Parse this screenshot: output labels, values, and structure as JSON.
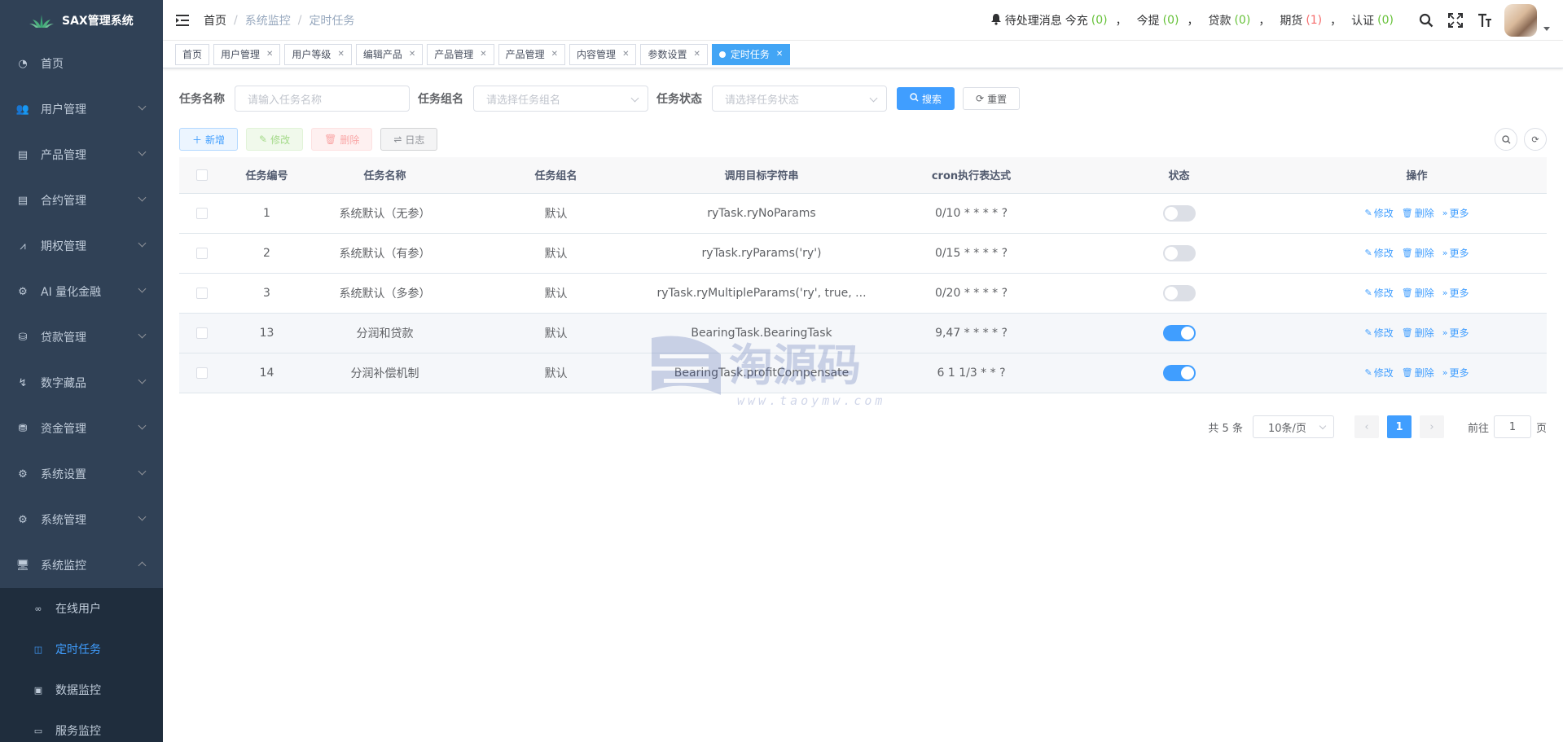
{
  "app": {
    "title": "SAX管理系统"
  },
  "sidebar": {
    "items": [
      {
        "label": "首页",
        "icon": "dashboard-icon",
        "glyph": "◔",
        "has_arrow": false
      },
      {
        "label": "用户管理",
        "icon": "peoples-icon",
        "glyph": "👥",
        "has_arrow": true
      },
      {
        "label": "产品管理",
        "icon": "document-icon",
        "glyph": "▤",
        "has_arrow": true
      },
      {
        "label": "合约管理",
        "icon": "contract-icon",
        "glyph": "▤",
        "has_arrow": true
      },
      {
        "label": "期权管理",
        "icon": "chart-icon",
        "glyph": "⩘",
        "has_arrow": true
      },
      {
        "label": "AI 量化金融",
        "icon": "ai-icon",
        "glyph": "⚙",
        "has_arrow": true
      },
      {
        "label": "贷款管理",
        "icon": "loan-icon",
        "glyph": "⛁",
        "has_arrow": true
      },
      {
        "label": "数字藏品",
        "icon": "nft-icon",
        "glyph": "↯",
        "has_arrow": true
      },
      {
        "label": "资金管理",
        "icon": "money-icon",
        "glyph": "⛃",
        "has_arrow": true
      },
      {
        "label": "系统设置",
        "icon": "gear-icon",
        "glyph": "⚙",
        "has_arrow": true
      },
      {
        "label": "系统管理",
        "icon": "system-icon",
        "glyph": "⚙",
        "has_arrow": true
      },
      {
        "label": "系统监控",
        "icon": "monitor-icon",
        "glyph": "🖥",
        "has_arrow": true,
        "expanded": true
      }
    ],
    "sub_items": [
      {
        "label": "在线用户",
        "icon": "online-icon",
        "glyph": "∞",
        "active": false
      },
      {
        "label": "定时任务",
        "icon": "job-icon",
        "glyph": "◫",
        "active": true
      },
      {
        "label": "数据监控",
        "icon": "druid-icon",
        "glyph": "▣",
        "active": false
      },
      {
        "label": "服务监控",
        "icon": "server-icon",
        "glyph": "▭",
        "active": false
      }
    ]
  },
  "header": {
    "breadcrumb": [
      "首页",
      "系统监控",
      "定时任务"
    ],
    "notice": {
      "label": "待处理消息",
      "items": [
        {
          "label": "今充",
          "count": "(0)",
          "color": "green"
        },
        {
          "label": "今提",
          "count": "(0)",
          "color": "green"
        },
        {
          "label": "贷款",
          "count": "(0)",
          "color": "green"
        },
        {
          "label": "期货",
          "count": "(1)",
          "color": "red"
        },
        {
          "label": "认证",
          "count": "(0)",
          "color": "green"
        }
      ]
    }
  },
  "tags": [
    {
      "label": "首页",
      "closable": false,
      "active": false
    },
    {
      "label": "用户管理",
      "closable": true,
      "active": false
    },
    {
      "label": "用户等级",
      "closable": true,
      "active": false
    },
    {
      "label": "编辑产品",
      "closable": true,
      "active": false
    },
    {
      "label": "产品管理",
      "closable": true,
      "active": false
    },
    {
      "label": "产品管理",
      "closable": true,
      "active": false
    },
    {
      "label": "内容管理",
      "closable": true,
      "active": false
    },
    {
      "label": "参数设置",
      "closable": true,
      "active": false
    },
    {
      "label": "定时任务",
      "closable": true,
      "active": true
    }
  ],
  "search": {
    "job_name_label": "任务名称",
    "job_name_placeholder": "请输入任务名称",
    "job_group_label": "任务组名",
    "job_group_placeholder": "请选择任务组名",
    "status_label": "任务状态",
    "status_placeholder": "请选择任务状态",
    "search_button": "搜索",
    "reset_button": "重置"
  },
  "toolbar": {
    "add": "新增",
    "edit": "修改",
    "delete": "删除",
    "log": "日志"
  },
  "table": {
    "columns": [
      "任务编号",
      "任务名称",
      "任务组名",
      "调用目标字符串",
      "cron执行表达式",
      "状态",
      "操作"
    ],
    "rows": [
      {
        "id": "1",
        "name": "系统默认（无参）",
        "group": "默认",
        "target": "ryTask.ryNoParams",
        "cron": "0/10 * * * * ?",
        "status": false
      },
      {
        "id": "2",
        "name": "系统默认（有参）",
        "group": "默认",
        "target": "ryTask.ryParams('ry')",
        "cron": "0/15 * * * * ?",
        "status": false
      },
      {
        "id": "3",
        "name": "系统默认（多参）",
        "group": "默认",
        "target": "ryTask.ryMultipleParams('ry', true, ...",
        "cron": "0/20 * * * * ?",
        "status": false
      },
      {
        "id": "13",
        "name": "分润和贷款",
        "group": "默认",
        "target": "BearingTask.BearingTask",
        "cron": "9,47 * * * * ?",
        "status": true
      },
      {
        "id": "14",
        "name": "分润补偿机制",
        "group": "默认",
        "target": "BearingTask.profitCompensate",
        "cron": "6 1 1/3 * * ?",
        "status": true
      }
    ],
    "actions": {
      "edit": "修改",
      "delete": "删除",
      "more": "更多"
    }
  },
  "pagination": {
    "total_text": "共 5 条",
    "page_size": "10条/页",
    "current_page": "1",
    "goto_label": "前往",
    "goto_value": "1",
    "goto_suffix": "页"
  },
  "watermark": {
    "text": "淘源码",
    "url": "www.taoymw.com"
  },
  "colors": {
    "sidebar_bg": "#304156",
    "primary": "#409eff",
    "active_tag": "#42a5f5"
  }
}
